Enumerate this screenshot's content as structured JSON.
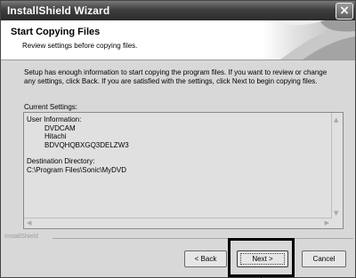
{
  "window": {
    "title": "InstallShield Wizard",
    "close_glyph": "×"
  },
  "header": {
    "title": "Start Copying Files",
    "subtitle": "Review settings before copying files."
  },
  "body": {
    "description": "Setup has enough information to start copying the program files.  If you want to review or change any settings, click Back.  If you are satisfied with the settings, click Next to begin copying files.",
    "current_settings_label": "Current Settings:"
  },
  "settings": {
    "user_info_label": "User Information:",
    "user_values": [
      "DVDCAM",
      "Hitachi",
      "BDVQHQBXGQ3DELZW3"
    ],
    "dest_label": "Destination Directory:",
    "dest_value": "C:\\Program Files\\Sonic\\MyDVD"
  },
  "footer": {
    "brand": "InstallShield"
  },
  "buttons": {
    "back": "< Back",
    "next": "Next >",
    "cancel": "Cancel"
  },
  "icons": {
    "close": "close-icon",
    "scroll_up": "scroll-up-icon",
    "scroll_down": "scroll-down-icon",
    "scroll_left": "scroll-left-icon",
    "scroll_right": "scroll-right-icon"
  }
}
